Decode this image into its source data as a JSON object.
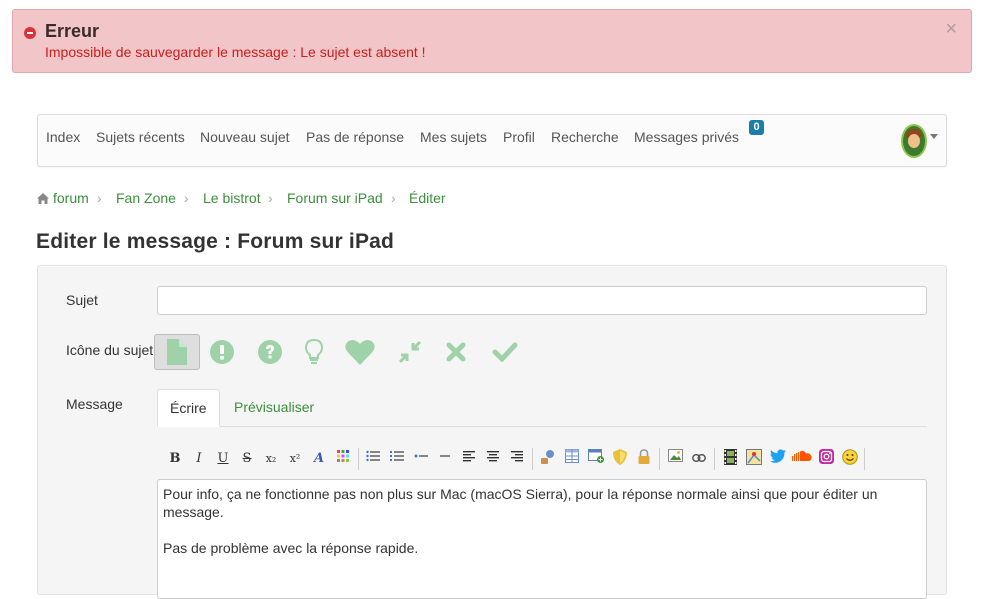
{
  "alert": {
    "title": "Erreur",
    "message": "Impossible de sauvegarder le message : Le sujet est absent !",
    "close_glyph": "×"
  },
  "nav": {
    "items": [
      "Index",
      "Sujets récents",
      "Nouveau sujet",
      "Pas de réponse",
      "Mes sujets",
      "Profil",
      "Recherche",
      "Messages privés"
    ],
    "pm_count": "0"
  },
  "breadcrumb": [
    "forum",
    "Fan Zone",
    "Le bistrot",
    "Forum sur iPad",
    "Éditer"
  ],
  "page_title": "Editer le message : Forum sur iPad",
  "form": {
    "subject_label": "Sujet",
    "subject_value": "",
    "icon_label": "Icône du sujet",
    "icons": [
      "document-icon",
      "exclamation-icon",
      "question-icon",
      "lightbulb-icon",
      "heart-icon",
      "compress-icon",
      "cross-icon",
      "check-icon"
    ],
    "message_label": "Message",
    "tabs": [
      "Écrire",
      "Prévisualiser"
    ],
    "message_lines": [
      "Pour info, ça ne fonctionne pas non plus sur Mac (macOS Sierra), pour la réponse normale ainsi que pour éditer un message.",
      "Pas de problème avec la réponse rapide."
    ]
  },
  "toolbar": {
    "bold": "B",
    "italic": "I",
    "underline": "U",
    "strike": "S",
    "sub": "x₂",
    "sup": "x²",
    "font": "A"
  },
  "colors": {
    "accent_green": "#3c8f3c",
    "icon_green": "#9fd2a8",
    "error_red": "#c81e1e",
    "badge_blue": "#1c7ea8"
  }
}
